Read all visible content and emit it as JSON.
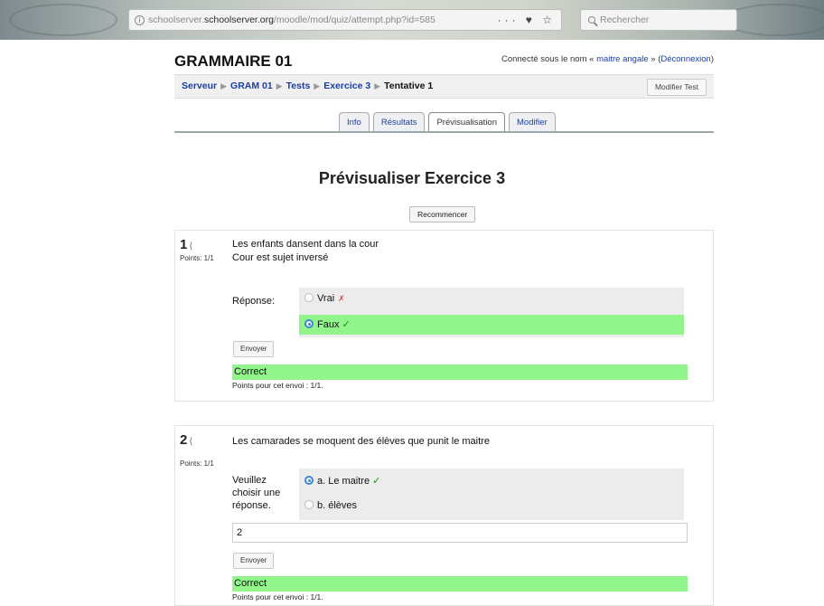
{
  "browser": {
    "url_prefix": "schoolserver.",
    "url_host": "schoolserver.org",
    "url_path": "/moodle/mod/quiz/attempt.php?id=585",
    "search_placeholder": "Rechercher",
    "actions": "··· ♥ ☆"
  },
  "header": {
    "course_title": "GRAMMAIRE 01",
    "login_prefix": "Connecté sous le nom «",
    "login_user": "maitre angale",
    "login_suffix": "» (",
    "logout_label": "Déconnexion",
    "logout_close": ")"
  },
  "breadcrumb": {
    "items": [
      "Serveur",
      "GRAM 01",
      "Tests",
      "Exercice 3"
    ],
    "current": "Tentative 1",
    "separator": "▶"
  },
  "edit_test_label": "Modifier Test",
  "tabs": [
    {
      "label": "Info",
      "active": false
    },
    {
      "label": "Résultats",
      "active": false
    },
    {
      "label": "Prévisualisation",
      "active": true
    },
    {
      "label": "Modifier",
      "active": false
    }
  ],
  "page_heading": "Prévisualiser Exercice 3",
  "restart_label": "Recommencer",
  "questions": [
    {
      "number": "1",
      "points": "Points: 1/1",
      "text_line1": "Les enfants dansent dans la cour",
      "text_line2": "Cour est sujet inversé",
      "answer_label": "Réponse:",
      "options": [
        {
          "label": "Vrai",
          "checked": false,
          "correct": false
        },
        {
          "label": "Faux",
          "checked": true,
          "correct": true
        }
      ],
      "submit_label": "Envoyer",
      "feedback": "Correct",
      "feedback_points": "Points pour cet envoi : 1/1."
    },
    {
      "number": "2",
      "points": "Points: 1/1",
      "text_line1": "Les camarades se moquent des élèves que punit le maitre",
      "answer_label": "Veuillez choisir une réponse.",
      "options": [
        {
          "label": "a. Le maitre",
          "checked": true,
          "correct": true
        },
        {
          "label": "b. élèves",
          "checked": false,
          "correct": false
        }
      ],
      "input_value": "2",
      "submit_label": "Envoyer",
      "feedback": "Correct",
      "feedback_points": "Points pour cet envoi : 1/1."
    }
  ],
  "colors": {
    "correct_bg": "#91f58b",
    "link": "#1a3fa0",
    "check": "#1e8a1e",
    "cross": "#e04a4a"
  }
}
